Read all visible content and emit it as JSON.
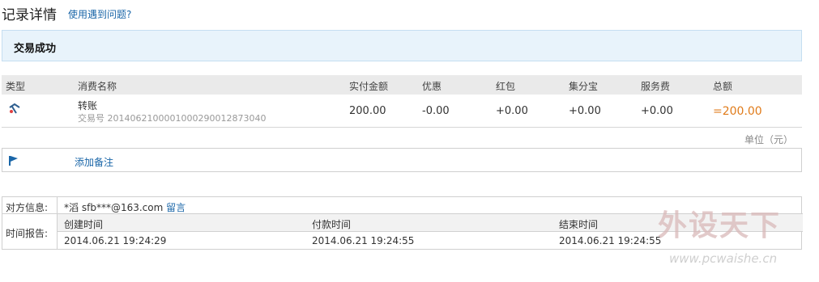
{
  "page": {
    "title": "记录详情",
    "help_link": "使用遇到问题?"
  },
  "status": {
    "text": "交易成功"
  },
  "table": {
    "columns": [
      "类型",
      "消费名称",
      "实付金额",
      "优惠",
      "红包",
      "集分宝",
      "服务费",
      "总额"
    ],
    "row": {
      "type_icon": "transfer-icon",
      "name": "转账",
      "trade_no_label": "交易号",
      "trade_no": "2014062100001000290012873040",
      "paid": "200.00",
      "discount": "-0.00",
      "red_packet": "+0.00",
      "points": "+0.00",
      "service_fee": "+0.00",
      "total": "=200.00"
    },
    "unit": "单位（元）"
  },
  "note": {
    "icon": "flag-icon",
    "label": "添加备注"
  },
  "counterparty": {
    "label": "对方信息:",
    "name": "*滔",
    "account": "sfb***@163.com",
    "message_link": "留言"
  },
  "timeline": {
    "label": "时间报告:",
    "columns": [
      "创建时间",
      "付款时间",
      "结束时间"
    ],
    "values": [
      "2014.06.21 19:24:29",
      "2014.06.21 19:24:55",
      "2014.06.21 19:24:55"
    ]
  },
  "watermark": {
    "text": "外设天下",
    "url": "www.pcwaishe.cn"
  },
  "colors": {
    "link": "#1a66a8",
    "total": "#e07b1a",
    "status_bg": "#e8f3fb"
  }
}
